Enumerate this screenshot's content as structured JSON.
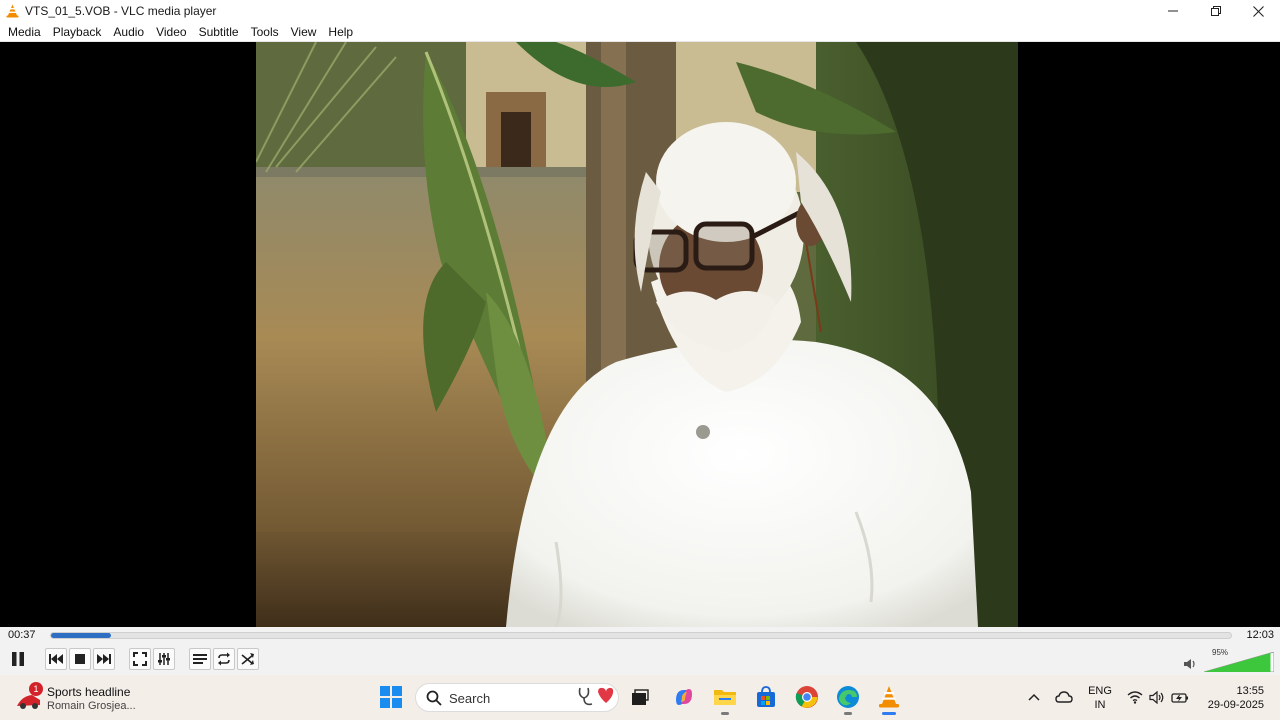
{
  "window": {
    "title": "VTS_01_5.VOB - VLC media player"
  },
  "menu": [
    "Media",
    "Playback",
    "Audio",
    "Video",
    "Subtitle",
    "Tools",
    "View",
    "Help"
  ],
  "player": {
    "time_elapsed": "00:37",
    "time_total": "12:03",
    "progress_fraction": 0.051,
    "volume_label": "95%",
    "volume_fraction": 0.95
  },
  "taskbar": {
    "news_title": "Sports headline",
    "news_subtitle": "Romain Grosjea...",
    "news_badge": "1",
    "search_placeholder": "Search",
    "lang_line1": "ENG",
    "lang_line2": "IN",
    "clock_time": "13:55",
    "clock_date": "29-09-2025"
  },
  "colors": {
    "accent": "#2e6fc4",
    "volume_green": "#3cc73c",
    "vlc_orange": "#f28c00"
  }
}
